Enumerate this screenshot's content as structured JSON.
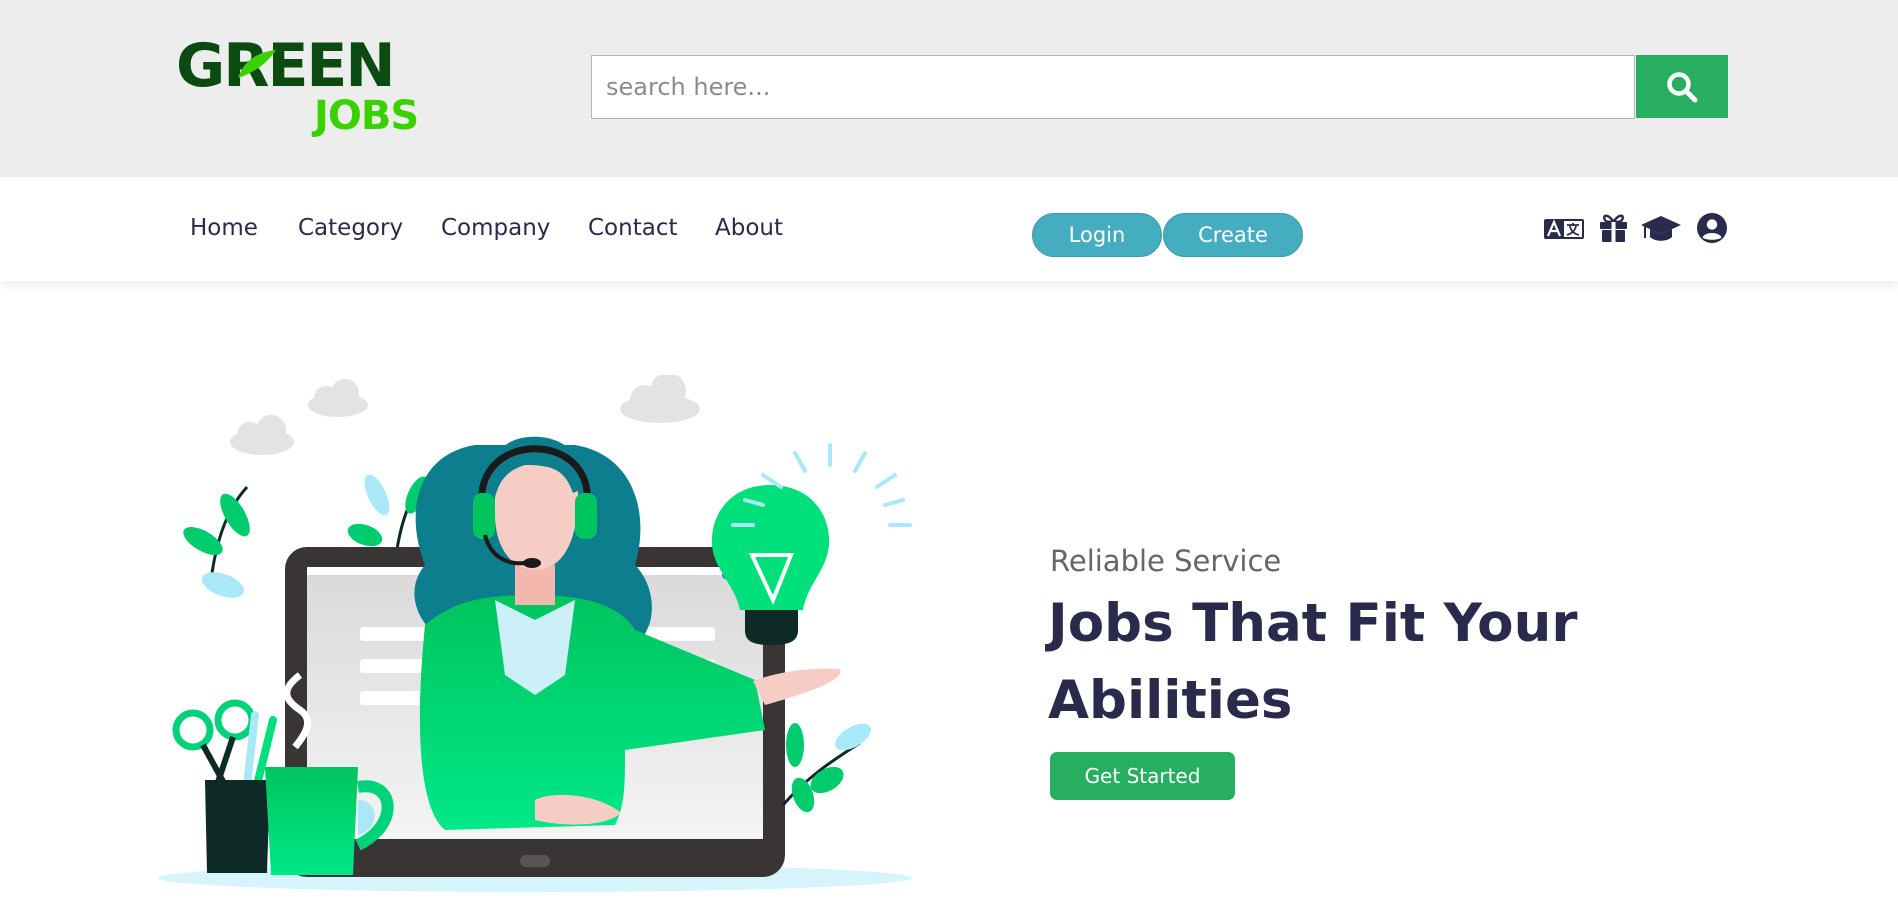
{
  "header": {
    "logo": {
      "word1": "GREEN",
      "word2": "JOBS"
    },
    "search": {
      "placeholder": "search here...",
      "value": "",
      "icon": "search-icon"
    }
  },
  "nav": {
    "links": [
      {
        "label": "Home"
      },
      {
        "label": "Category"
      },
      {
        "label": "Company"
      },
      {
        "label": "Contact"
      },
      {
        "label": "About"
      }
    ],
    "login_label": "Login",
    "create_label": "Create",
    "icons": [
      "language-icon",
      "gift-icon",
      "graduation-cap-icon",
      "user-icon"
    ]
  },
  "hero": {
    "eyebrow": "Reliable Service",
    "headline": "Jobs That Fit Your Abilities",
    "cta_label": "Get Started"
  },
  "colors": {
    "brand_green": "#27ae60",
    "logo_dark_green": "#0b4a10",
    "logo_light_green": "#3bd100",
    "pill_blue": "#45adc0",
    "heading_navy": "#2a2a4d",
    "topbar_bg": "#ededed"
  }
}
